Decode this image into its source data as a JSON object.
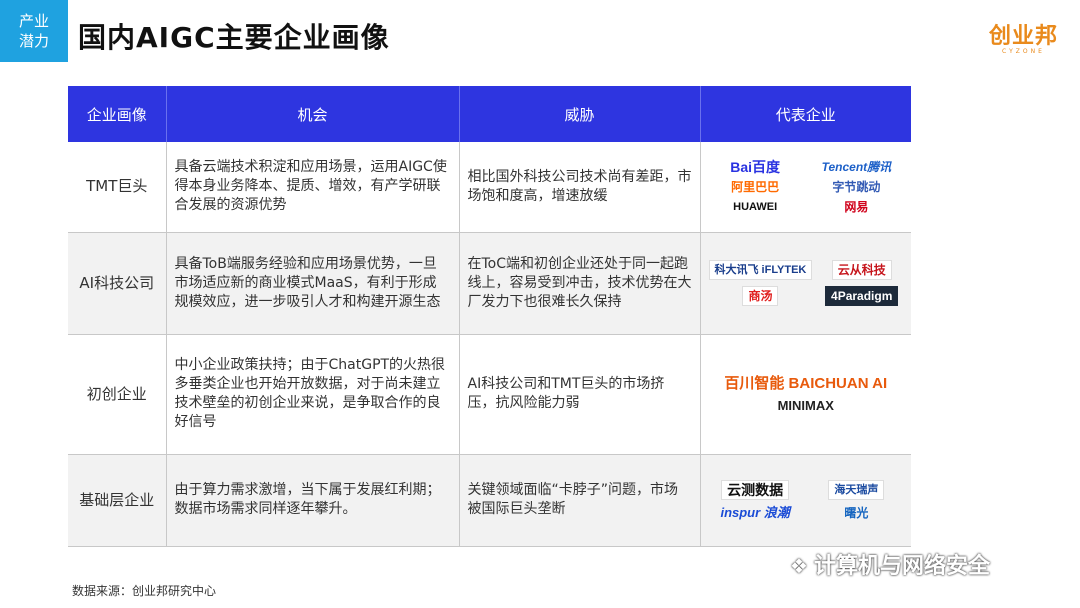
{
  "header": {
    "tag_line1": "产业",
    "tag_line2": "潜力",
    "title": "国内AIGC主要企业画像",
    "brand": "创业邦",
    "brand_sub": "CYZONE"
  },
  "table": {
    "columns": [
      "企业画像",
      "机会",
      "威胁",
      "代表企业"
    ],
    "rows": [
      {
        "category": "TMT巨头",
        "opportunity": "具备云端技术积淀和应用场景，运用AIGC使得本身业务降本、提质、增效，有产学研联合发展的资源优势",
        "threat": "相比国外科技公司技术尚有差距，市场饱和度高，增速放缓",
        "logos": [
          "Bai百度",
          "Tencent腾讯",
          "阿里巴巴",
          "字节跳动",
          "HUAWEI",
          "网易"
        ]
      },
      {
        "category": "AI科技公司",
        "opportunity": "具备ToB端服务经验和应用场景优势，一旦市场适应新的商业模式MaaS，有利于形成规模效应，进一步吸引人才和构建开源生态",
        "threat": "在ToC端和初创企业还处于同一起跑线上，容易受到冲击，技术优势在大厂发力下也很难长久保持",
        "logos": [
          "科大讯飞 iFLYTEK",
          "云从科技",
          "商汤",
          "4Paradigm"
        ]
      },
      {
        "category": "初创企业",
        "opportunity": "中小企业政策扶持；由于ChatGPT的火热很多垂类企业也开始开放数据，对于尚未建立技术壁垒的初创企业来说，是争取合作的良好信号",
        "threat": "AI科技公司和TMT巨头的市场挤压，抗风险能力弱",
        "logos": [
          "百川智能 BAICHUAN AI",
          "MINIMAX"
        ]
      },
      {
        "category": "基础层企业",
        "opportunity": "由于算力需求激增，当下属于发展红利期；数据市场需求同样逐年攀升。",
        "threat": "关键领域面临“卡脖子”问题，市场被国际巨头垄断",
        "logos": [
          "云测数据",
          "海天瑞声",
          "inspur 浪潮",
          "曙光"
        ]
      }
    ]
  },
  "source": "数据来源：创业邦研究中心",
  "watermark": "计算机与网络安全",
  "colors": {
    "header_bg": "#2e35e0",
    "tag_bg": "#1fa2e0",
    "brand": "#e98a1c"
  }
}
